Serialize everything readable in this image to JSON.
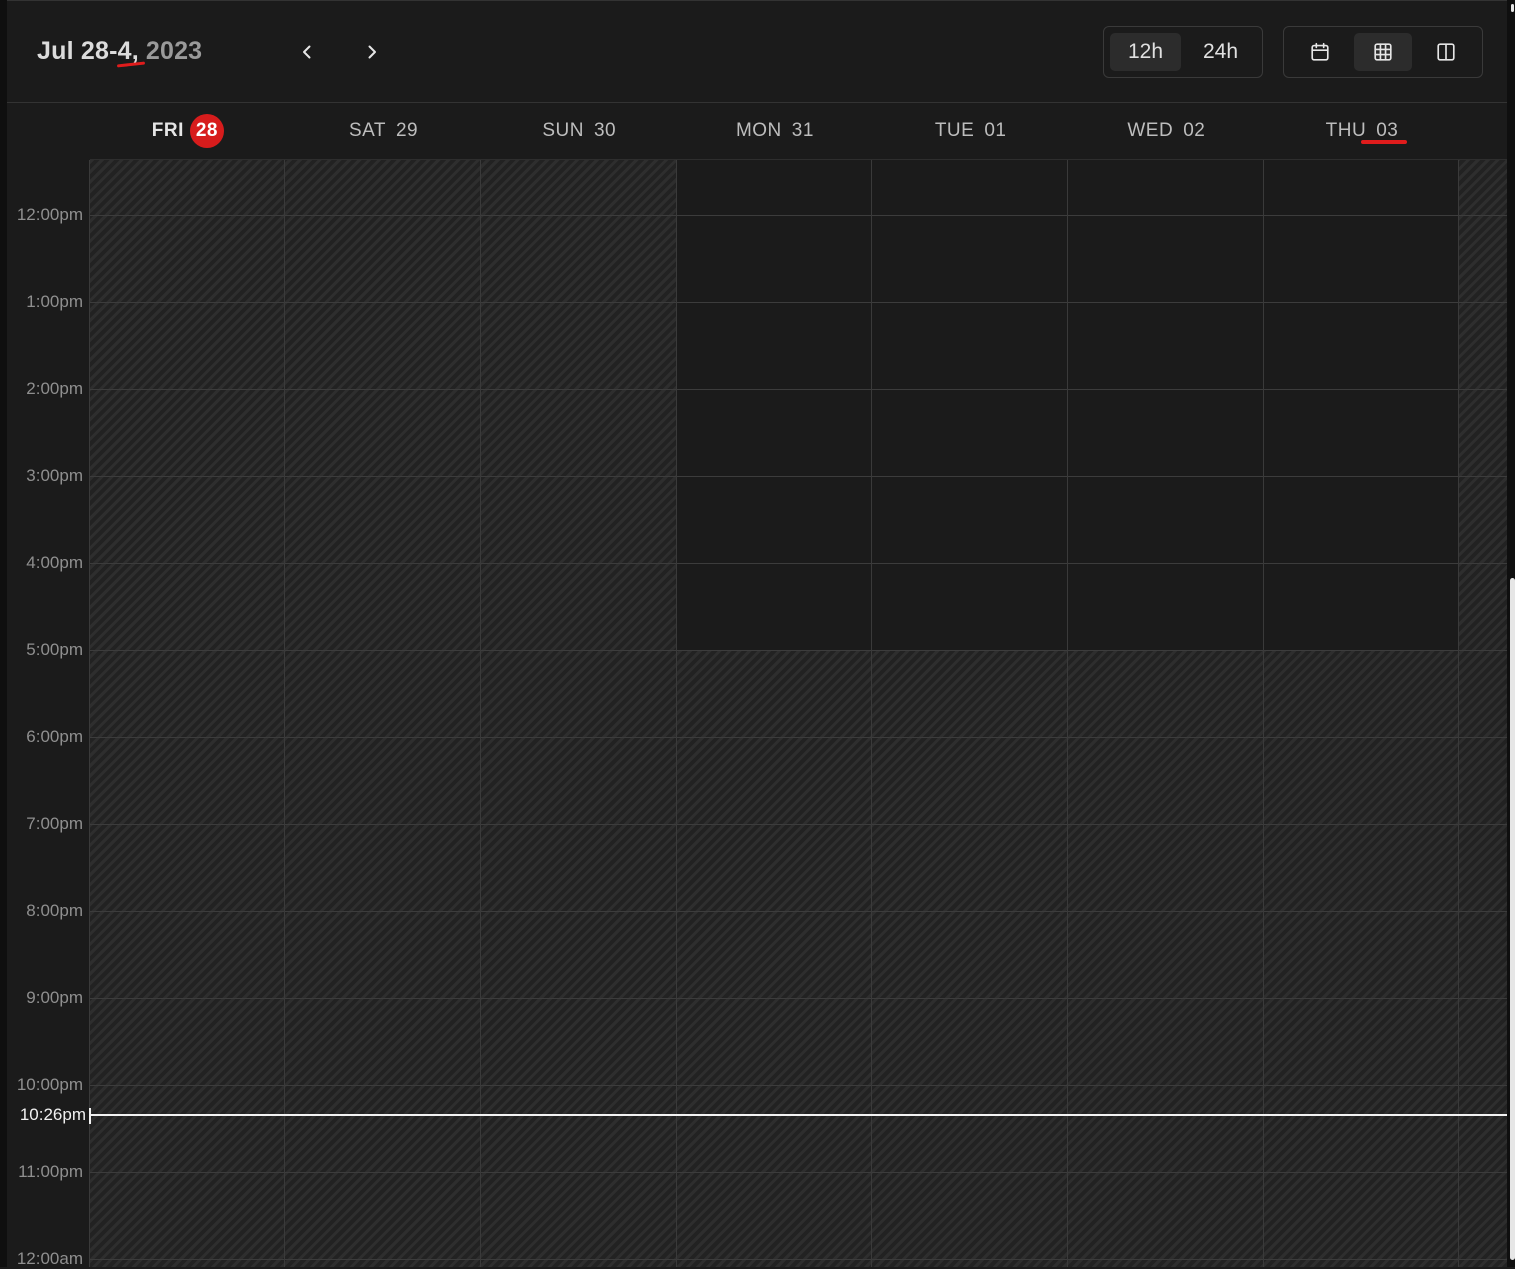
{
  "header": {
    "range": "Jul 28-4,",
    "year": "2023",
    "prev_icon": "chevron-left-icon",
    "next_icon": "chevron-right-icon"
  },
  "time_format": {
    "options": [
      "12h",
      "24h"
    ],
    "selected": "12h"
  },
  "view_toggle": {
    "icons": [
      "calendar-icon",
      "grid-icon",
      "columns-icon"
    ],
    "selected": "grid-icon"
  },
  "days": [
    {
      "dow": "FRI",
      "num": "28",
      "today": true
    },
    {
      "dow": "SAT",
      "num": "29"
    },
    {
      "dow": "SUN",
      "num": "30"
    },
    {
      "dow": "MON",
      "num": "31"
    },
    {
      "dow": "TUE",
      "num": "01"
    },
    {
      "dow": "WED",
      "num": "02"
    },
    {
      "dow": "THU",
      "num": "03"
    }
  ],
  "time_labels": [
    "12:00pm",
    "1:00pm",
    "2:00pm",
    "3:00pm",
    "4:00pm",
    "5:00pm",
    "6:00pm",
    "7:00pm",
    "8:00pm",
    "9:00pm",
    "10:00pm",
    "11:00pm",
    "12:00am"
  ],
  "now": "10:26pm",
  "colors": {
    "today_badge": "#d71c1c",
    "annotation": "#e01c1c",
    "now_line": "#f2f2f2"
  }
}
